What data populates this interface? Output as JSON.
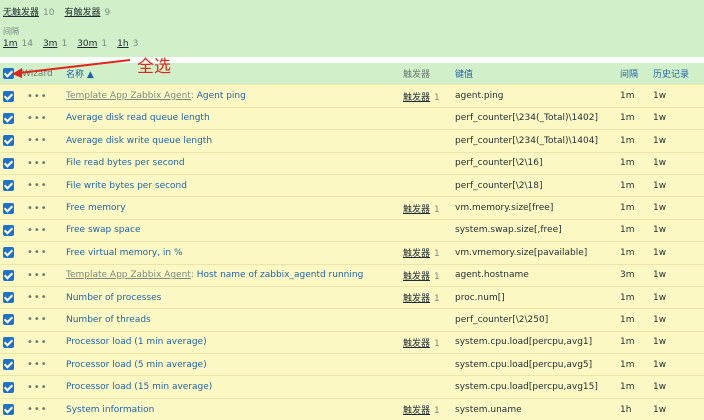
{
  "filter": {
    "without_triggers": {
      "label": "无触发器",
      "count": "10"
    },
    "with_triggers": {
      "label": "有触发器",
      "count": "9"
    },
    "interval_label": "间隔",
    "intervals": [
      {
        "label": "1m",
        "count": "14"
      },
      {
        "label": "3m",
        "count": "1"
      },
      {
        "label": "30m",
        "count": "1"
      },
      {
        "label": "1h",
        "count": "3"
      }
    ]
  },
  "annotation": {
    "label": "全选",
    "color": "#e0261b"
  },
  "table": {
    "headers": {
      "wizard": "Wizard",
      "name": "名称 ▲",
      "triggers": "触发器",
      "key": "键值",
      "interval": "间隔",
      "history": "历史记录"
    },
    "rows": [
      {
        "template": "Template App Zabbix Agent",
        "name": "Agent ping",
        "triggers": "触发器",
        "trigger_count": "1",
        "key": "agent.ping",
        "interval": "1m",
        "history": "1w"
      },
      {
        "template": "",
        "name": "Average disk read queue length",
        "triggers": "",
        "trigger_count": "",
        "key": "perf_counter[\\234(_Total)\\1402]",
        "interval": "1m",
        "history": "1w"
      },
      {
        "template": "",
        "name": "Average disk write queue length",
        "triggers": "",
        "trigger_count": "",
        "key": "perf_counter[\\234(_Total)\\1404]",
        "interval": "1m",
        "history": "1w"
      },
      {
        "template": "",
        "name": "File read bytes per second",
        "triggers": "",
        "trigger_count": "",
        "key": "perf_counter[\\2\\16]",
        "interval": "1m",
        "history": "1w"
      },
      {
        "template": "",
        "name": "File write bytes per second",
        "triggers": "",
        "trigger_count": "",
        "key": "perf_counter[\\2\\18]",
        "interval": "1m",
        "history": "1w"
      },
      {
        "template": "",
        "name": "Free memory",
        "triggers": "触发器",
        "trigger_count": "1",
        "key": "vm.memory.size[free]",
        "interval": "1m",
        "history": "1w"
      },
      {
        "template": "",
        "name": "Free swap space",
        "triggers": "",
        "trigger_count": "",
        "key": "system.swap.size[,free]",
        "interval": "1m",
        "history": "1w"
      },
      {
        "template": "",
        "name": "Free virtual memory, in %",
        "triggers": "触发器",
        "trigger_count": "1",
        "key": "vm.vmemory.size[pavailable]",
        "interval": "1m",
        "history": "1w"
      },
      {
        "template": "Template App Zabbix Agent",
        "name": "Host name of zabbix_agentd running",
        "triggers": "触发器",
        "trigger_count": "1",
        "key": "agent.hostname",
        "interval": "3m",
        "history": "1w"
      },
      {
        "template": "",
        "name": "Number of processes",
        "triggers": "触发器",
        "trigger_count": "1",
        "key": "proc.num[]",
        "interval": "1m",
        "history": "1w"
      },
      {
        "template": "",
        "name": "Number of threads",
        "triggers": "",
        "trigger_count": "",
        "key": "perf_counter[\\2\\250]",
        "interval": "1m",
        "history": "1w"
      },
      {
        "template": "",
        "name": "Processor load (1 min average)",
        "triggers": "触发器",
        "trigger_count": "1",
        "key": "system.cpu.load[percpu,avg1]",
        "interval": "1m",
        "history": "1w"
      },
      {
        "template": "",
        "name": "Processor load (5 min average)",
        "triggers": "",
        "trigger_count": "",
        "key": "system.cpu.load[percpu,avg5]",
        "interval": "1m",
        "history": "1w"
      },
      {
        "template": "",
        "name": "Processor load (15 min average)",
        "triggers": "",
        "trigger_count": "",
        "key": "system.cpu.load[percpu,avg15]",
        "interval": "1m",
        "history": "1w"
      },
      {
        "template": "",
        "name": "System information",
        "triggers": "触发器",
        "trigger_count": "1",
        "key": "system.uname",
        "interval": "1h",
        "history": "1w"
      }
    ]
  }
}
